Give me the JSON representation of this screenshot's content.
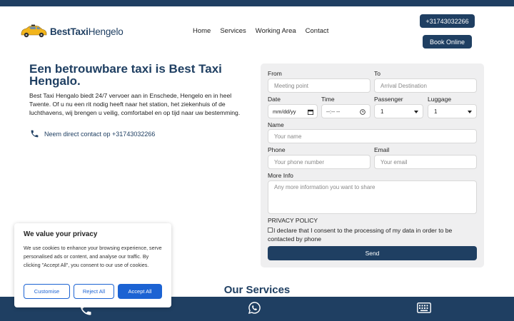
{
  "brand": {
    "name_bold": "BestTaxi",
    "name_rest": "Hengelo"
  },
  "nav": [
    "Home",
    "Services",
    "Working Area",
    "Contact"
  ],
  "header": {
    "phone_button": "+31743032266",
    "book_button": "Book Online"
  },
  "hero": {
    "title": "Een betrouwbare taxi is Best Taxi Hengalo.",
    "text": "Best Taxi Hengalo biedt 24/7 vervoer aan in Enschede, Hengelo en in heel Twente. Of u nu een rit nodig heeft naar het station, het ziekenhuis of de luchthavens, wij brengen u veilig, comfortabel en op tijd naar uw bestemming.",
    "contact": "Neem direct contact op +31743032266"
  },
  "form": {
    "from_label": "From",
    "from_placeholder": "Meeting point",
    "to_label": "To",
    "to_placeholder": "Arrival Destination",
    "date_label": "Date",
    "date_value": "mm/dd/yy",
    "time_label": "Time",
    "time_value": "--:-- --",
    "passenger_label": "Passenger",
    "passenger_value": "1",
    "luggage_label": "Luggage",
    "luggage_value": "1",
    "name_label": "Name",
    "name_placeholder": "Your name",
    "phone_label": "Phone",
    "phone_placeholder": "Your phone number",
    "email_label": "Email",
    "email_placeholder": "Your email",
    "info_label": "More Info",
    "info_placeholder": "Any more information you want to share",
    "privacy_label": "PRIVACY POLICY",
    "consent": "I declare that I consent to the processing of my data in order to be contacted by phone",
    "send": "Send"
  },
  "cookie": {
    "title": "We value your privacy",
    "text": "We use cookies to enhance your browsing experience, serve personalised ads or content, and analyse our traffic. By clicking \"Accept All\", you consent to our use of cookies.",
    "customise": "Customise",
    "reject": "Reject All",
    "accept": "Accept All"
  },
  "services_title": "Our Services",
  "bottom_icons": [
    "phone-icon",
    "whatsapp-icon",
    "keyboard-icon"
  ],
  "colors": {
    "primary": "#1f3f62",
    "cookie_accent": "#1c63d3",
    "form_bg": "#efeff0"
  }
}
